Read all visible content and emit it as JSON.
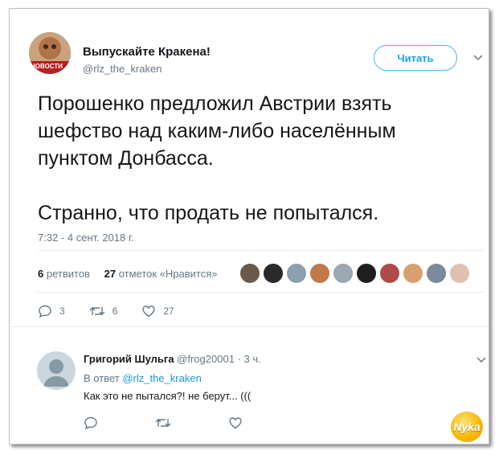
{
  "tweet": {
    "display_name": "Выпускайте Кракена!",
    "handle": "@rlz_the_kraken",
    "follow_label": "Читать",
    "text": "Порошенко предложил Австрии взять\nшефство над каким-либо населённым\nпунктом Донбасса.\n\nСтранно, что продать не попытался.",
    "timestamp": "7:32 - 4 сент. 2018 г.",
    "retweets_count": "6",
    "retweets_label": "ретвитов",
    "likes_count": "27",
    "likes_label": "отметок «Нравится»",
    "avatar_text": "НОВОСТИ",
    "actions": {
      "replies": "3",
      "retweets": "6",
      "likes": "27"
    }
  },
  "reply": {
    "display_name": "Григорий Шульга",
    "handle": "@frog20001",
    "time": "· 3 ч.",
    "reply_to_label": "В ответ",
    "reply_to_handle": "@rlz_the_kraken",
    "text": "Как это не пытался?! не берут... (((",
    "actions": {
      "replies": "",
      "retweets": "",
      "likes": ""
    }
  },
  "likers": [
    "#6b5a4a",
    "#2a2a2a",
    "#8aa0b0",
    "#c07a4a",
    "#9aa8b4",
    "#1e1e1e",
    "#b04a4a",
    "#d8a070",
    "#7a8a9a",
    "#e0c0b0"
  ],
  "colors": {
    "accent": "#1da1f2",
    "link": "#1b95e0",
    "muted": "#657786"
  },
  "watermark": "Nyka"
}
